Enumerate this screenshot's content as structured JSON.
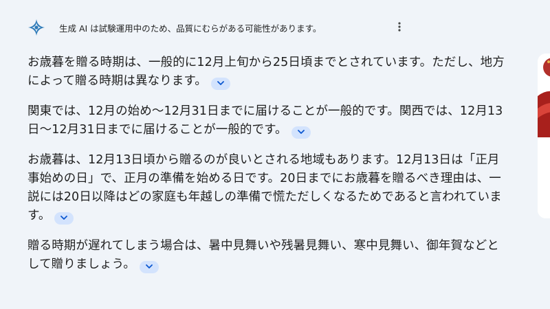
{
  "header": {
    "disclaimer": "生成 AI は試験運用中のため、品質にむらがある可能性があります。",
    "logo_icon": "sparkle-icon",
    "menu_icon": "more-vert-icon"
  },
  "paragraphs": [
    {
      "text": "お歳暮を贈る時期は、一般的に12月上旬から25日頃までとされています。ただし、地方によって贈る時期は異なります。"
    },
    {
      "text": "関東では、12月の始め～12月31日までに届けることが一般的です。関西では、12月13日～12月31日までに届けることが一般的です。"
    },
    {
      "text": "お歳暮は、12月13日頃から贈るのが良いとされる地域もあります。12月13日は「正月事始めの日」で、正月の準備を始める日です。20日までにお歳暮を贈るべき理由は、一説には20日以降はどの家庭も年越しの準備で慌ただしくなるためであると言われています。"
    },
    {
      "text": "贈る時期が遅れてしまう場合は、暑中見舞いや残暑見舞い、寒中見舞い、御年賀などとして贈りましょう。"
    }
  ],
  "colors": {
    "background": "#f0f4f9",
    "chip": "#d3e3fd",
    "chevron": "#0b57d0",
    "logo": "#2d7ab8",
    "image_red": "#c0392b"
  },
  "expand_icon": "chevron-down-icon"
}
